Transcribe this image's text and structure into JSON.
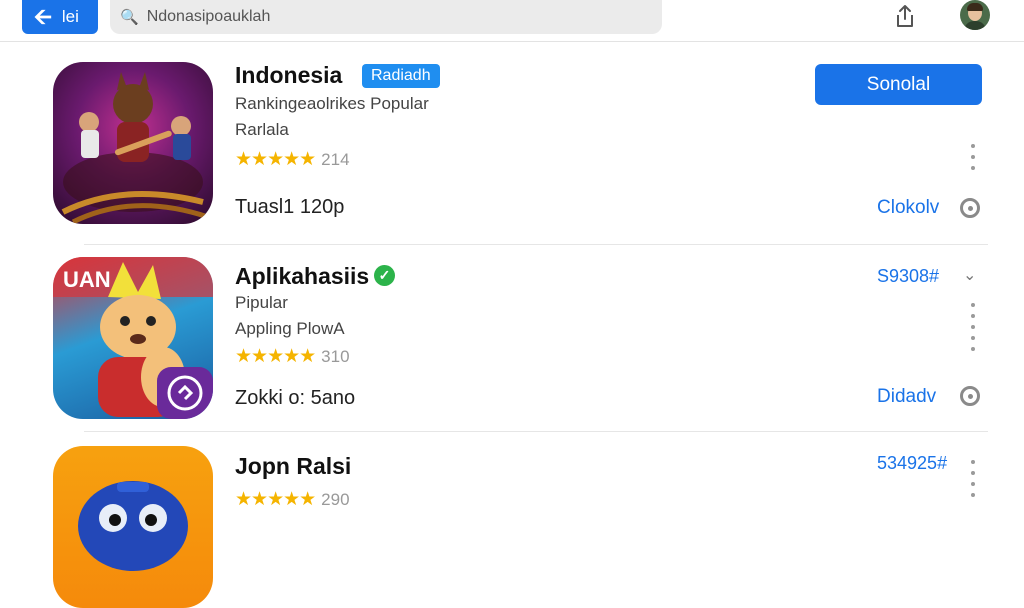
{
  "topbar": {
    "back_label": "lei",
    "back_icon": "arrow-left-icon",
    "search_placeholder": "Ndonasipoauklah",
    "search_icon": "search-icon",
    "share_icon": "share-icon",
    "avatar_icon": "user-avatar"
  },
  "apps": [
    {
      "title": "Indonesia",
      "badge": "Radiadh",
      "line1": "Rankingeaolrikes Popular",
      "line2": "Rarlala",
      "stars": "★★★★★",
      "rating_count": "214",
      "footer": "Tuasl1 120p",
      "primary_button": "Sonolal",
      "link": "Clokolv",
      "accent": "#1a73e8"
    },
    {
      "title": "Aplikahasiis",
      "verified_icon": "check-circle-icon",
      "line1": "Pipular",
      "line2": "Appling PlowA",
      "stars": "★★★★★",
      "rating_count": "310",
      "footer": "Zokki o: 5ano",
      "price": "S9308#",
      "link": "Didadv",
      "icon_badge": "UAN"
    },
    {
      "title": "Jopn Ralsi",
      "stars": "★★★★★",
      "rating_count": "290",
      "price": "534925#"
    }
  ]
}
